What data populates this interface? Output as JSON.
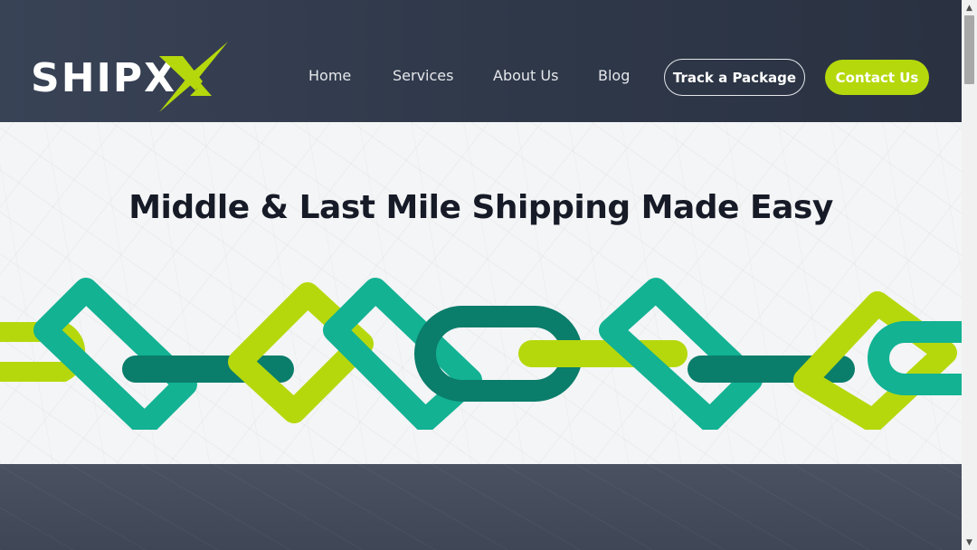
{
  "header": {
    "logo_text": "SHIPX",
    "nav": [
      {
        "label": "Home"
      },
      {
        "label": "Services"
      },
      {
        "label": "About Us"
      },
      {
        "label": "Blog"
      }
    ],
    "track_label": "Track a Package",
    "contact_label": "Contact Us"
  },
  "hero": {
    "title": "Middle & Last Mile Shipping Made Easy"
  },
  "colors": {
    "header_bg": "#323b4d",
    "accent_lime": "#b5d80c",
    "accent_teal": "#12b293",
    "accent_dark_teal": "#0a7d6b",
    "title_text": "#161b27",
    "hero_bg": "#f4f5f6"
  }
}
